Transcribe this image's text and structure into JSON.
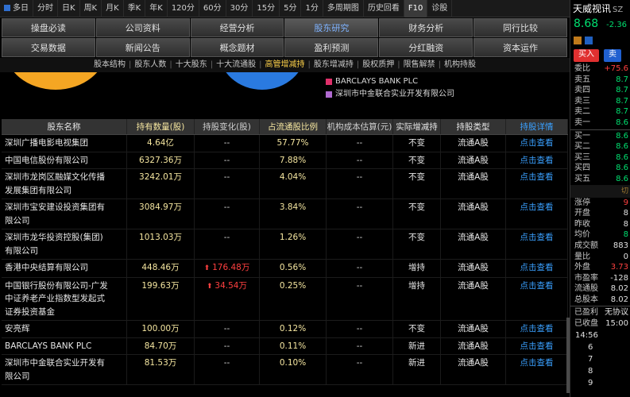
{
  "toolbar": {
    "items": [
      "多日",
      "分时",
      "日K",
      "周K",
      "月K",
      "季K",
      "年K",
      "120分",
      "60分",
      "30分",
      "15分",
      "5分",
      "1分",
      "多周期图",
      "历史回看",
      "F10",
      "诊股"
    ],
    "active": "F10"
  },
  "tabs": {
    "row1": [
      "操盘必读",
      "公司资料",
      "经营分析",
      "股东研究",
      "财务分析",
      "同行比较"
    ],
    "row2": [
      "交易数据",
      "新闻公告",
      "概念题材",
      "盈利预测",
      "分红融资",
      "资本运作"
    ],
    "active": "股东研究"
  },
  "subnav": {
    "items": [
      "股本结构",
      "股东人数",
      "十大股东",
      "十大流通股",
      "高管增减持",
      "股东增减持",
      "股权质押",
      "限售解禁",
      "机构持股"
    ],
    "active": "高管增减持"
  },
  "legend": [
    {
      "label": "BARCLAYS BANK PLC",
      "color": "#e0306a"
    },
    {
      "label": "深圳市中金联合实业开发有限公司",
      "color": "#b06ad0"
    }
  ],
  "pie_colors": {
    "left": "#f5a623",
    "right": "#2a7ae0"
  },
  "table": {
    "headers": [
      "股东名称",
      "持有数量(股)",
      "持股变化(股)",
      "占流通股比例",
      "机构成本估算(元)",
      "实际增减持",
      "持股类型",
      "持股详情"
    ],
    "rows": [
      {
        "name": [
          "深圳广播电影电视集团"
        ],
        "qty": "4.64亿",
        "change": "--",
        "up": false,
        "ratio": "57.77%",
        "cost": "--",
        "act": "不变",
        "type": "流通A股",
        "detail": "点击查看"
      },
      {
        "name": [
          "中国电信股份有限公司"
        ],
        "qty": "6327.36万",
        "change": "--",
        "up": false,
        "ratio": "7.88%",
        "cost": "--",
        "act": "不变",
        "type": "流通A股",
        "detail": "点击查看"
      },
      {
        "name": [
          "深圳市龙岗区融媒文化传播",
          "发展集团有限公司"
        ],
        "qty": "3242.01万",
        "change": "--",
        "up": false,
        "ratio": "4.04%",
        "cost": "--",
        "act": "不变",
        "type": "流通A股",
        "detail": "点击查看"
      },
      {
        "name": [
          "深圳市宝安建设投资集团有",
          "限公司"
        ],
        "qty": "3084.97万",
        "change": "--",
        "up": false,
        "ratio": "3.84%",
        "cost": "--",
        "act": "不变",
        "type": "流通A股",
        "detail": "点击查看"
      },
      {
        "name": [
          "深圳市龙华投资控股(集团)",
          "有限公司"
        ],
        "qty": "1013.03万",
        "change": "--",
        "up": false,
        "ratio": "1.26%",
        "cost": "--",
        "act": "不变",
        "type": "流通A股",
        "detail": "点击查看"
      },
      {
        "name": [
          "香港中央结算有限公司"
        ],
        "qty": "448.46万",
        "change": "176.48万",
        "up": true,
        "ratio": "0.56%",
        "cost": "--",
        "act": "增持",
        "type": "流通A股",
        "detail": "点击查看"
      },
      {
        "name": [
          "中国银行股份有限公司-广发",
          "中证养老产业指数型发起式",
          "证券投资基金"
        ],
        "qty": "199.63万",
        "change": "34.54万",
        "up": true,
        "ratio": "0.25%",
        "cost": "--",
        "act": "增持",
        "type": "流通A股",
        "detail": "点击查看"
      },
      {
        "name": [
          "安亮辉"
        ],
        "qty": "100.00万",
        "change": "--",
        "up": false,
        "ratio": "0.12%",
        "cost": "--",
        "act": "不变",
        "type": "流通A股",
        "detail": "点击查看"
      },
      {
        "name": [
          "BARCLAYS BANK PLC"
        ],
        "qty": "84.70万",
        "change": "--",
        "up": false,
        "ratio": "0.11%",
        "cost": "--",
        "act": "新进",
        "type": "流通A股",
        "detail": "点击查看"
      },
      {
        "name": [
          "深圳市中金联合实业开发有",
          "限公司"
        ],
        "qty": "81.53万",
        "change": "--",
        "up": false,
        "ratio": "0.10%",
        "cost": "--",
        "act": "新进",
        "type": "流通A股",
        "detail": "点击查看"
      }
    ]
  },
  "right": {
    "title": "天威视讯",
    "code": "SZ",
    "price": "8.68",
    "delta": "-2.36",
    "buy": "买入",
    "sell": "卖",
    "rows1": [
      {
        "l": "委比",
        "v": "+75.6",
        "c": "r"
      },
      {
        "l": "卖五",
        "v": "8.7",
        "c": "g"
      },
      {
        "l": "卖四",
        "v": "8.7",
        "c": "g"
      },
      {
        "l": "卖三",
        "v": "8.7",
        "c": "g"
      },
      {
        "l": "卖二",
        "v": "8.7",
        "c": "g"
      },
      {
        "l": "卖一",
        "v": "8.6",
        "c": "g"
      }
    ],
    "rows2": [
      {
        "l": "买一",
        "v": "8.6",
        "c": "g"
      },
      {
        "l": "买二",
        "v": "8.6",
        "c": "g"
      },
      {
        "l": "买三",
        "v": "8.6",
        "c": "g"
      },
      {
        "l": "买四",
        "v": "8.6",
        "c": "g"
      },
      {
        "l": "买五",
        "v": "8.6",
        "c": "g"
      }
    ],
    "switch": "切",
    "rows3": [
      {
        "l": "涨停",
        "v": "9",
        "c": "r"
      },
      {
        "l": "开盘",
        "v": "8",
        "c": "w"
      },
      {
        "l": "昨收",
        "v": "8",
        "c": "w"
      },
      {
        "l": "均价",
        "v": "8",
        "c": "g"
      },
      {
        "l": "成交额",
        "v": "883",
        "c": "w"
      },
      {
        "l": "量比",
        "v": "0",
        "c": "w"
      },
      {
        "l": "外盘",
        "v": "3.73",
        "c": "r"
      },
      {
        "l": "市盈率",
        "v": "-128",
        "c": "w"
      },
      {
        "l": "流通股",
        "v": "8.02",
        "c": "w"
      },
      {
        "l": "总股本",
        "v": "8.02",
        "c": "w"
      }
    ],
    "rows4": [
      {
        "l": "已盈利",
        "v": "无协议",
        "c": "w"
      },
      {
        "l": "已收盘",
        "v": "15:00",
        "c": "w"
      }
    ],
    "ticks": [
      "14:56",
      "6",
      "7",
      "8",
      "9"
    ]
  }
}
